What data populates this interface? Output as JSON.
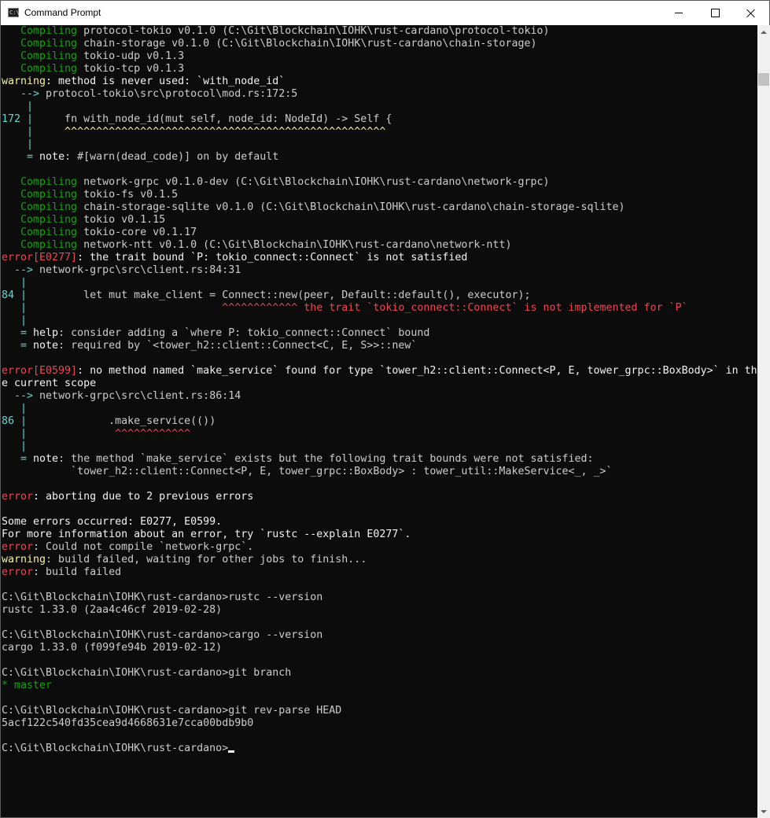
{
  "window": {
    "title": "Command Prompt",
    "app_icon_text": "C:\\"
  },
  "colors": {
    "background": "#0c0c0c",
    "text": "#cccccc",
    "compiling": "#13a10e",
    "warning": "#f9f1a5",
    "error": "#e74856",
    "line_number": "#61d6d6"
  },
  "console": {
    "lines": [
      [
        {
          "c": "g",
          "t": "   Compiling"
        },
        {
          "t": " protocol-tokio v0.1.0 (C:\\Git\\Blockchain\\IOHK\\rust-cardano\\protocol-tokio)"
        }
      ],
      [
        {
          "c": "g",
          "t": "   Compiling"
        },
        {
          "t": " chain-storage v0.1.0 (C:\\Git\\Blockchain\\IOHK\\rust-cardano\\chain-storage)"
        }
      ],
      [
        {
          "c": "g",
          "t": "   Compiling"
        },
        {
          "t": " tokio-udp v0.1.3"
        }
      ],
      [
        {
          "c": "g",
          "t": "   Compiling"
        },
        {
          "t": " tokio-tcp v0.1.3"
        }
      ],
      [
        {
          "c": "y",
          "t": "warning"
        },
        {
          "c": "w",
          "t": ": method is never used: `with_node_id`"
        }
      ],
      [
        {
          "c": "c",
          "t": "   --> "
        },
        {
          "t": "protocol-tokio\\src\\protocol\\mod.rs:172:5"
        }
      ],
      [
        {
          "c": "c",
          "t": "    |"
        }
      ],
      [
        {
          "c": "c",
          "t": "172 |"
        },
        {
          "t": "     fn with_node_id(mut self, node_id: NodeId) -> Self {"
        }
      ],
      [
        {
          "c": "c",
          "t": "    |"
        },
        {
          "c": "y",
          "t": "     ^^^^^^^^^^^^^^^^^^^^^^^^^^^^^^^^^^^^^^^^^^^^^^^^^^^"
        }
      ],
      [
        {
          "c": "c",
          "t": "    |"
        }
      ],
      [
        {
          "c": "c",
          "t": "    = "
        },
        {
          "c": "w",
          "t": "note"
        },
        {
          "t": ": #[warn(dead_code)] on by default"
        }
      ],
      [],
      [
        {
          "c": "g",
          "t": "   Compiling"
        },
        {
          "t": " network-grpc v0.1.0-dev (C:\\Git\\Blockchain\\IOHK\\rust-cardano\\network-grpc)"
        }
      ],
      [
        {
          "c": "g",
          "t": "   Compiling"
        },
        {
          "t": " tokio-fs v0.1.5"
        }
      ],
      [
        {
          "c": "g",
          "t": "   Compiling"
        },
        {
          "t": " chain-storage-sqlite v0.1.0 (C:\\Git\\Blockchain\\IOHK\\rust-cardano\\chain-storage-sqlite)"
        }
      ],
      [
        {
          "c": "g",
          "t": "   Compiling"
        },
        {
          "t": " tokio v0.1.15"
        }
      ],
      [
        {
          "c": "g",
          "t": "   Compiling"
        },
        {
          "t": " tokio-core v0.1.17"
        }
      ],
      [
        {
          "c": "g",
          "t": "   Compiling"
        },
        {
          "t": " network-ntt v0.1.0 (C:\\Git\\Blockchain\\IOHK\\rust-cardano\\network-ntt)"
        }
      ],
      [
        {
          "c": "r",
          "t": "error[E0277]"
        },
        {
          "c": "w",
          "t": ": the trait bound `P: tokio_connect::Connect` is not satisfied"
        }
      ],
      [
        {
          "c": "c",
          "t": "  --> "
        },
        {
          "t": "network-grpc\\src\\client.rs:84:31"
        }
      ],
      [
        {
          "c": "c",
          "t": "   |"
        }
      ],
      [
        {
          "c": "c",
          "t": "84 |"
        },
        {
          "t": "         let mut make_client = Connect::new(peer, Default::default(), executor);"
        }
      ],
      [
        {
          "c": "c",
          "t": "   |"
        },
        {
          "c": "r",
          "t": "                               ^^^^^^^^^^^^ the trait `tokio_connect::Connect` is not implemented for `P`"
        }
      ],
      [
        {
          "c": "c",
          "t": "   |"
        }
      ],
      [
        {
          "c": "c",
          "t": "   = "
        },
        {
          "c": "w",
          "t": "help"
        },
        {
          "t": ": consider adding a `where P: tokio_connect::Connect` bound"
        }
      ],
      [
        {
          "c": "c",
          "t": "   = "
        },
        {
          "c": "w",
          "t": "note"
        },
        {
          "t": ": required by `<tower_h2::client::Connect<C, E, S>>::new`"
        }
      ],
      [],
      [
        {
          "c": "r",
          "t": "error[E0599]"
        },
        {
          "c": "w",
          "t": ": no method named `make_service` found for type `tower_h2::client::Connect<P, E, tower_grpc::BoxBody>` in th"
        }
      ],
      [
        {
          "c": "w",
          "t": "e current scope"
        }
      ],
      [
        {
          "c": "c",
          "t": "  --> "
        },
        {
          "t": "network-grpc\\src\\client.rs:86:14"
        }
      ],
      [
        {
          "c": "c",
          "t": "   |"
        }
      ],
      [
        {
          "c": "c",
          "t": "86 |"
        },
        {
          "t": "             .make_service(())"
        }
      ],
      [
        {
          "c": "c",
          "t": "   |"
        },
        {
          "c": "r",
          "t": "              ^^^^^^^^^^^^"
        }
      ],
      [
        {
          "c": "c",
          "t": "   |"
        }
      ],
      [
        {
          "c": "c",
          "t": "   = "
        },
        {
          "c": "w",
          "t": "note"
        },
        {
          "t": ": the method `make_service` exists but the following trait bounds were not satisfied:"
        }
      ],
      [
        {
          "t": "           `tower_h2::client::Connect<P, E, tower_grpc::BoxBody> : tower_util::MakeService<_, _>`"
        }
      ],
      [],
      [
        {
          "c": "r",
          "t": "error"
        },
        {
          "c": "w",
          "t": ": aborting due to 2 previous errors"
        }
      ],
      [],
      [
        {
          "c": "w",
          "t": "Some errors occurred: E0277, E0599."
        }
      ],
      [
        {
          "c": "w",
          "t": "For more information about an error, try `rustc --explain E0277`."
        }
      ],
      [
        {
          "c": "r",
          "t": "error"
        },
        {
          "t": ": Could not compile `network-grpc`."
        }
      ],
      [
        {
          "c": "y",
          "t": "warning"
        },
        {
          "t": ": build failed, waiting for other jobs to finish..."
        }
      ],
      [
        {
          "c": "r",
          "t": "error"
        },
        {
          "t": ": build failed"
        }
      ],
      [],
      [
        {
          "t": "C:\\Git\\Blockchain\\IOHK\\rust-cardano>rustc --version"
        }
      ],
      [
        {
          "t": "rustc 1.33.0 (2aa4c46cf 2019-02-28)"
        }
      ],
      [],
      [
        {
          "t": "C:\\Git\\Blockchain\\IOHK\\rust-cardano>cargo --version"
        }
      ],
      [
        {
          "t": "cargo 1.33.0 (f099fe94b 2019-02-12)"
        }
      ],
      [],
      [
        {
          "t": "C:\\Git\\Blockchain\\IOHK\\rust-cardano>git branch"
        }
      ],
      [
        {
          "c": "g",
          "t": "* master"
        }
      ],
      [],
      [
        {
          "t": "C:\\Git\\Blockchain\\IOHK\\rust-cardano>git rev-parse HEAD"
        }
      ],
      [
        {
          "t": "5acf122c540fd35cea9d4668631e7cca00bdb9b0"
        }
      ],
      [],
      [
        {
          "t": "C:\\Git\\Blockchain\\IOHK\\rust-cardano>"
        },
        {
          "cursor": true
        }
      ]
    ]
  }
}
